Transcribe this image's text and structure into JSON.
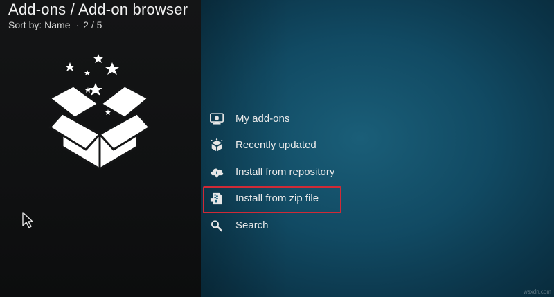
{
  "header": {
    "title": "Add-ons / Add-on browser",
    "sort_label": "Sort by: Name",
    "separator": "·",
    "position": "2 / 5"
  },
  "hero": {
    "icon": "open-box-with-stars-icon"
  },
  "menu": {
    "items": [
      {
        "label": "My add-ons",
        "icon": "monitor-addons-icon",
        "selected": false
      },
      {
        "label": "Recently updated",
        "icon": "box-refresh-icon",
        "selected": false
      },
      {
        "label": "Install from repository",
        "icon": "cloud-download-icon",
        "selected": false
      },
      {
        "label": "Install from zip file",
        "icon": "zip-file-icon",
        "selected": true
      },
      {
        "label": "Search",
        "icon": "search-icon",
        "selected": false
      }
    ]
  },
  "cursor": {
    "icon": "mouse-pointer-icon"
  },
  "watermark": {
    "text": "wsxdn.com"
  },
  "colors": {
    "highlight_border": "#d02a36",
    "right_panel": "#114a63",
    "left_panel": "#121314",
    "text": "#eaeaea"
  }
}
